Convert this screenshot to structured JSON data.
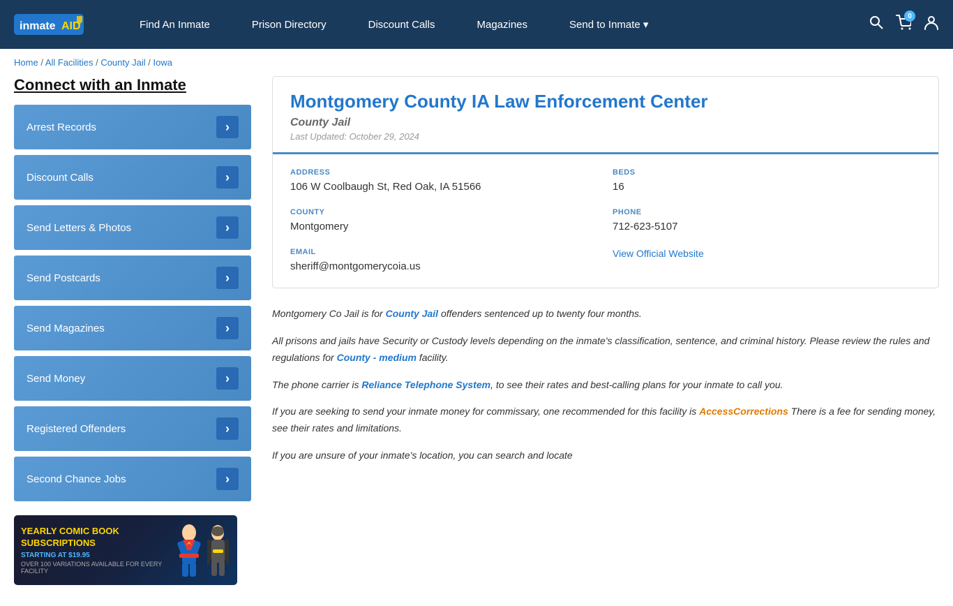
{
  "header": {
    "logo": "inmateAID",
    "logo_badge": "AID",
    "nav": [
      {
        "label": "Find An Inmate",
        "id": "find-inmate"
      },
      {
        "label": "Prison Directory",
        "id": "prison-directory"
      },
      {
        "label": "Discount Calls",
        "id": "discount-calls"
      },
      {
        "label": "Magazines",
        "id": "magazines"
      },
      {
        "label": "Send to Inmate ▾",
        "id": "send-to-inmate"
      }
    ],
    "cart_count": "0"
  },
  "breadcrumb": {
    "items": [
      {
        "label": "Home",
        "href": "#"
      },
      {
        "label": "All Facilities",
        "href": "#"
      },
      {
        "label": "County Jail",
        "href": "#"
      },
      {
        "label": "Iowa",
        "href": "#"
      }
    ]
  },
  "sidebar": {
    "title": "Connect with an Inmate",
    "items": [
      {
        "label": "Arrest Records"
      },
      {
        "label": "Discount Calls"
      },
      {
        "label": "Send Letters & Photos"
      },
      {
        "label": "Send Postcards"
      },
      {
        "label": "Send Magazines"
      },
      {
        "label": "Send Money"
      },
      {
        "label": "Registered Offenders"
      },
      {
        "label": "Second Chance Jobs"
      }
    ]
  },
  "ad": {
    "title": "YEARLY COMIC BOOK\nSUBSCRIPTIONS",
    "subtitle": "STARTING AT $19.95",
    "desc": "OVER 100 VARIATIONS AVAILABLE FOR EVERY FACILITY"
  },
  "facility": {
    "title": "Montgomery County IA Law Enforcement Center",
    "type": "County Jail",
    "last_updated": "Last Updated: October 29, 2024",
    "address_label": "ADDRESS",
    "address": "106 W Coolbaugh St, Red Oak, IA 51566",
    "beds_label": "BEDS",
    "beds": "16",
    "county_label": "COUNTY",
    "county": "Montgomery",
    "phone_label": "PHONE",
    "phone": "712-623-5107",
    "email_label": "EMAIL",
    "email": "sheriff@montgomerycoia.us",
    "website_label": "View Official Website",
    "website_href": "#"
  },
  "description": {
    "para1": "Montgomery Co Jail is for ",
    "para1_link": "County Jail",
    "para1_rest": " offenders sentenced up to twenty four months.",
    "para2": "All prisons and jails have Security or Custody levels depending on the inmate's classification, sentence, and criminal history. Please review the rules and regulations for ",
    "para2_link": "County - medium",
    "para2_rest": " facility.",
    "para3": "The phone carrier is ",
    "para3_link": "Reliance Telephone System",
    "para3_rest": ", to see their rates and best-calling plans for your inmate to call you.",
    "para4": "If you are seeking to send your inmate money for commissary, one recommended for this facility is ",
    "para4_link": "AccessCorrections",
    "para4_rest": " There is a fee for sending money, see their rates and limitations.",
    "para5": "If you are unsure of your inmate's location, you can search and locate"
  }
}
